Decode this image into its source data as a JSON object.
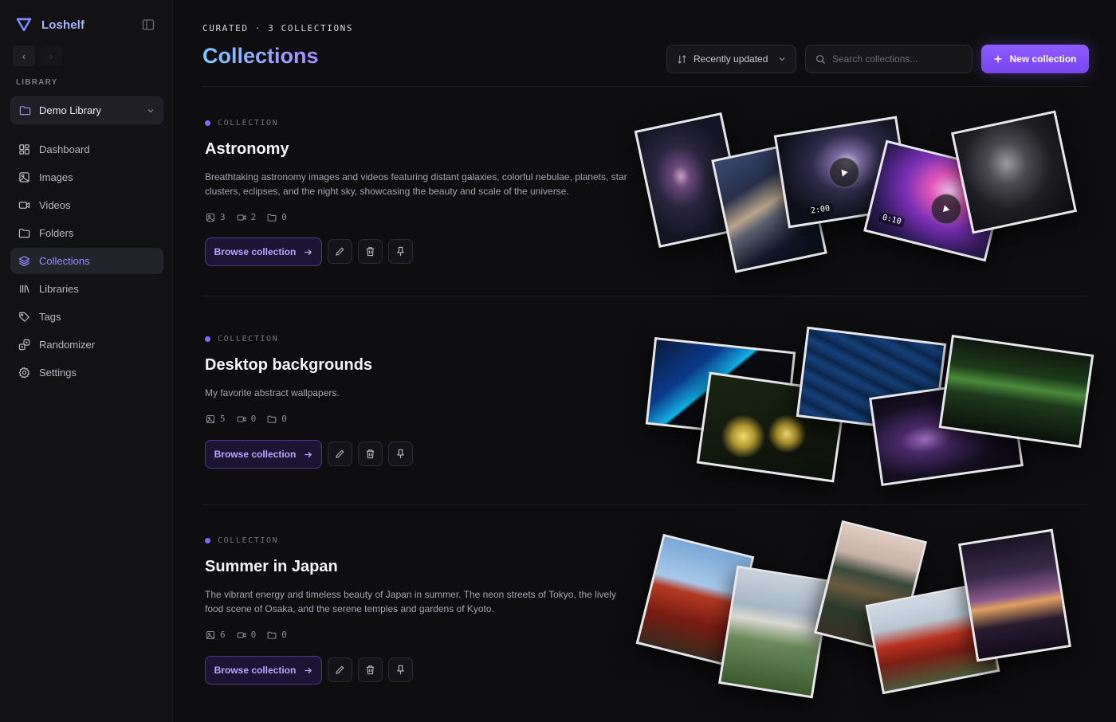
{
  "app": {
    "name": "Loshelf"
  },
  "sidebar": {
    "section_label": "LIBRARY",
    "library": "Demo Library",
    "items": [
      {
        "label": "Dashboard",
        "icon": "dashboard-icon",
        "active": false
      },
      {
        "label": "Images",
        "icon": "image-icon",
        "active": false
      },
      {
        "label": "Videos",
        "icon": "video-icon",
        "active": false
      },
      {
        "label": "Folders",
        "icon": "folder-icon",
        "active": false
      },
      {
        "label": "Collections",
        "icon": "layers-icon",
        "active": true
      },
      {
        "label": "Libraries",
        "icon": "library-icon",
        "active": false
      },
      {
        "label": "Tags",
        "icon": "tag-icon",
        "active": false
      },
      {
        "label": "Randomizer",
        "icon": "shuffle-icon",
        "active": false
      },
      {
        "label": "Settings",
        "icon": "gear-icon",
        "active": false
      }
    ]
  },
  "header": {
    "eyebrow": "CURATED · 3 COLLECTIONS",
    "title": "Collections",
    "sort_label": "Recently updated",
    "search_placeholder": "Search collections...",
    "new_label": "New collection"
  },
  "collections": [
    {
      "tag": "COLLECTION",
      "title": "Astronomy",
      "description": "Breathtaking astronomy images and videos featuring distant galaxies, colorful nebulae, planets, star clusters, eclipses, and the night sky, showcasing the beauty and scale of the universe.",
      "images": "3",
      "videos": "2",
      "folders": "0",
      "browse_label": "Browse collection",
      "durations": [
        "2:00",
        "0:10"
      ]
    },
    {
      "tag": "COLLECTION",
      "title": "Desktop backgrounds",
      "description": "My favorite abstract wallpapers.",
      "images": "5",
      "videos": "0",
      "folders": "0",
      "browse_label": "Browse collection"
    },
    {
      "tag": "COLLECTION",
      "title": "Summer in Japan",
      "description": "The vibrant energy and timeless beauty of Japan in summer. The neon streets of Tokyo, the lively food scene of Osaka, and the serene temples and gardens of Kyoto.",
      "images": "6",
      "videos": "0",
      "folders": "0",
      "browse_label": "Browse collection"
    }
  ],
  "colors": {
    "accent": "#8b5cf6",
    "active_nav": "#9c8cff",
    "background": "#0e0e10"
  }
}
